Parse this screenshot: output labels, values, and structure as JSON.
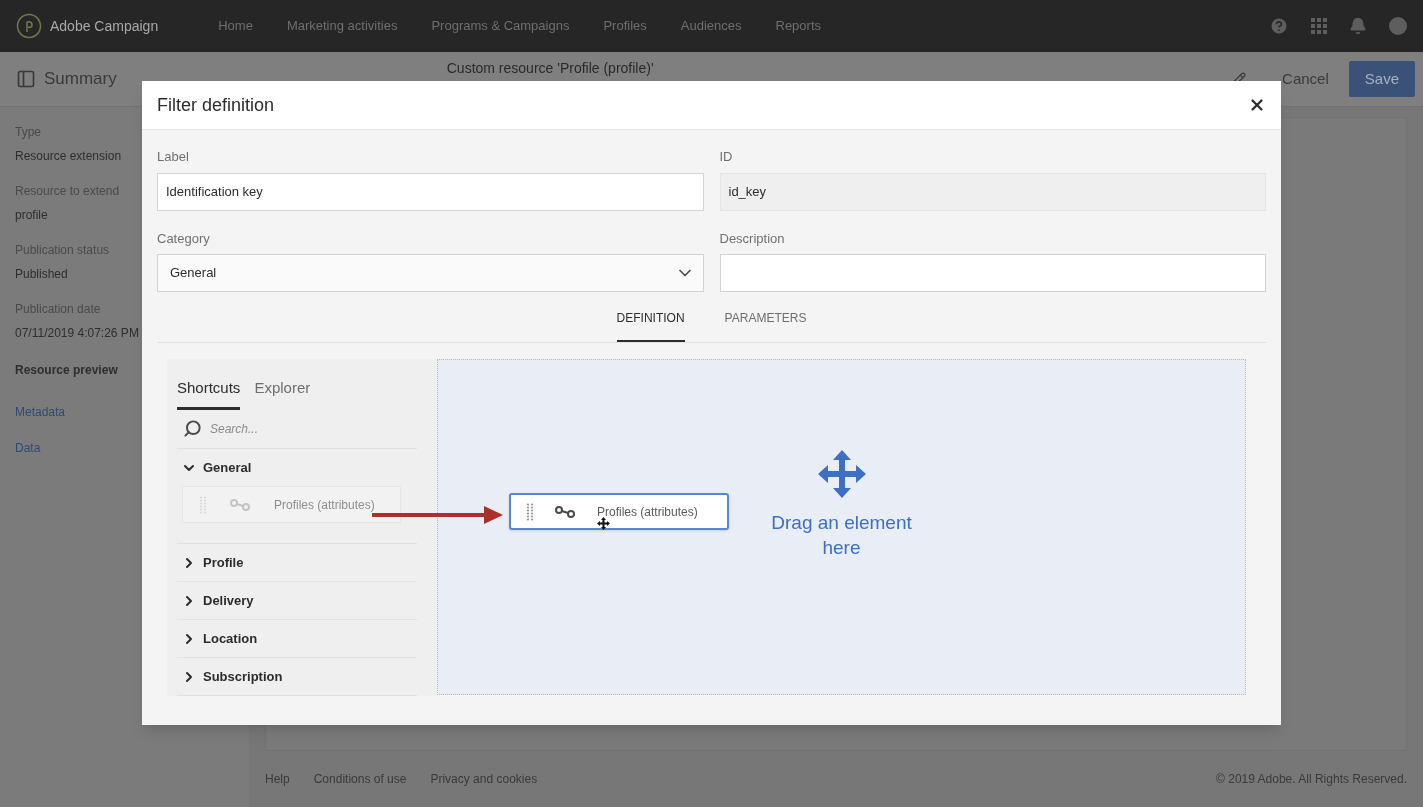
{
  "app": {
    "name": "Adobe Campaign"
  },
  "nav": [
    {
      "label": "Home"
    },
    {
      "label": "Marketing activities"
    },
    {
      "label": "Programs & Campaigns"
    },
    {
      "label": "Profiles"
    },
    {
      "label": "Audiences"
    },
    {
      "label": "Reports"
    }
  ],
  "subheader": {
    "title": "Summary",
    "resource": "Custom resource 'Profile (profile)'",
    "cancel": "Cancel",
    "save": "Save"
  },
  "summary": [
    {
      "label": "Type",
      "value": "Resource extension"
    },
    {
      "label": "Resource to extend",
      "value": "profile"
    },
    {
      "label": "Publication status",
      "value": "Published"
    },
    {
      "label": "Publication date",
      "value": "07/11/2019 4:07:26 PM"
    }
  ],
  "preview": {
    "heading": "Resource preview",
    "links": [
      "Metadata",
      "Data"
    ]
  },
  "footer": {
    "links": [
      "Help",
      "Conditions of use",
      "Privacy and cookies"
    ],
    "copyright": "© 2019 Adobe. All Rights Reserved."
  },
  "dialog": {
    "title": "Filter definition",
    "fields": [
      {
        "kind": "text",
        "label": "Label",
        "value": "Identification key",
        "disabled": false
      },
      {
        "kind": "text",
        "label": "ID",
        "value": "id_key",
        "disabled": true
      },
      {
        "kind": "select",
        "label": "Category",
        "value": "General"
      },
      {
        "kind": "text",
        "label": "Description",
        "disabled": false
      }
    ],
    "tabs": [
      {
        "label": "DEFINITION",
        "selected": true
      },
      {
        "label": "PARAMETERS",
        "selected": false
      }
    ],
    "palette": {
      "tabs": [
        {
          "label": "Shortcuts",
          "selected": true
        },
        {
          "label": "Explorer",
          "selected": false
        }
      ],
      "search": {
        "placeholder": "Search..."
      },
      "groups": [
        {
          "label": "General",
          "expanded": true,
          "items": [
            {
              "label": "Profiles (attributes)",
              "dragging": true
            }
          ]
        },
        {
          "label": "Profile",
          "expanded": false
        },
        {
          "label": "Delivery",
          "expanded": false
        },
        {
          "label": "Location",
          "expanded": false
        },
        {
          "label": "Subscription",
          "expanded": false
        }
      ]
    },
    "drag_item": {
      "label": "Profiles (attributes)"
    },
    "drop_zone": {
      "text": "Drag an element here"
    }
  }
}
